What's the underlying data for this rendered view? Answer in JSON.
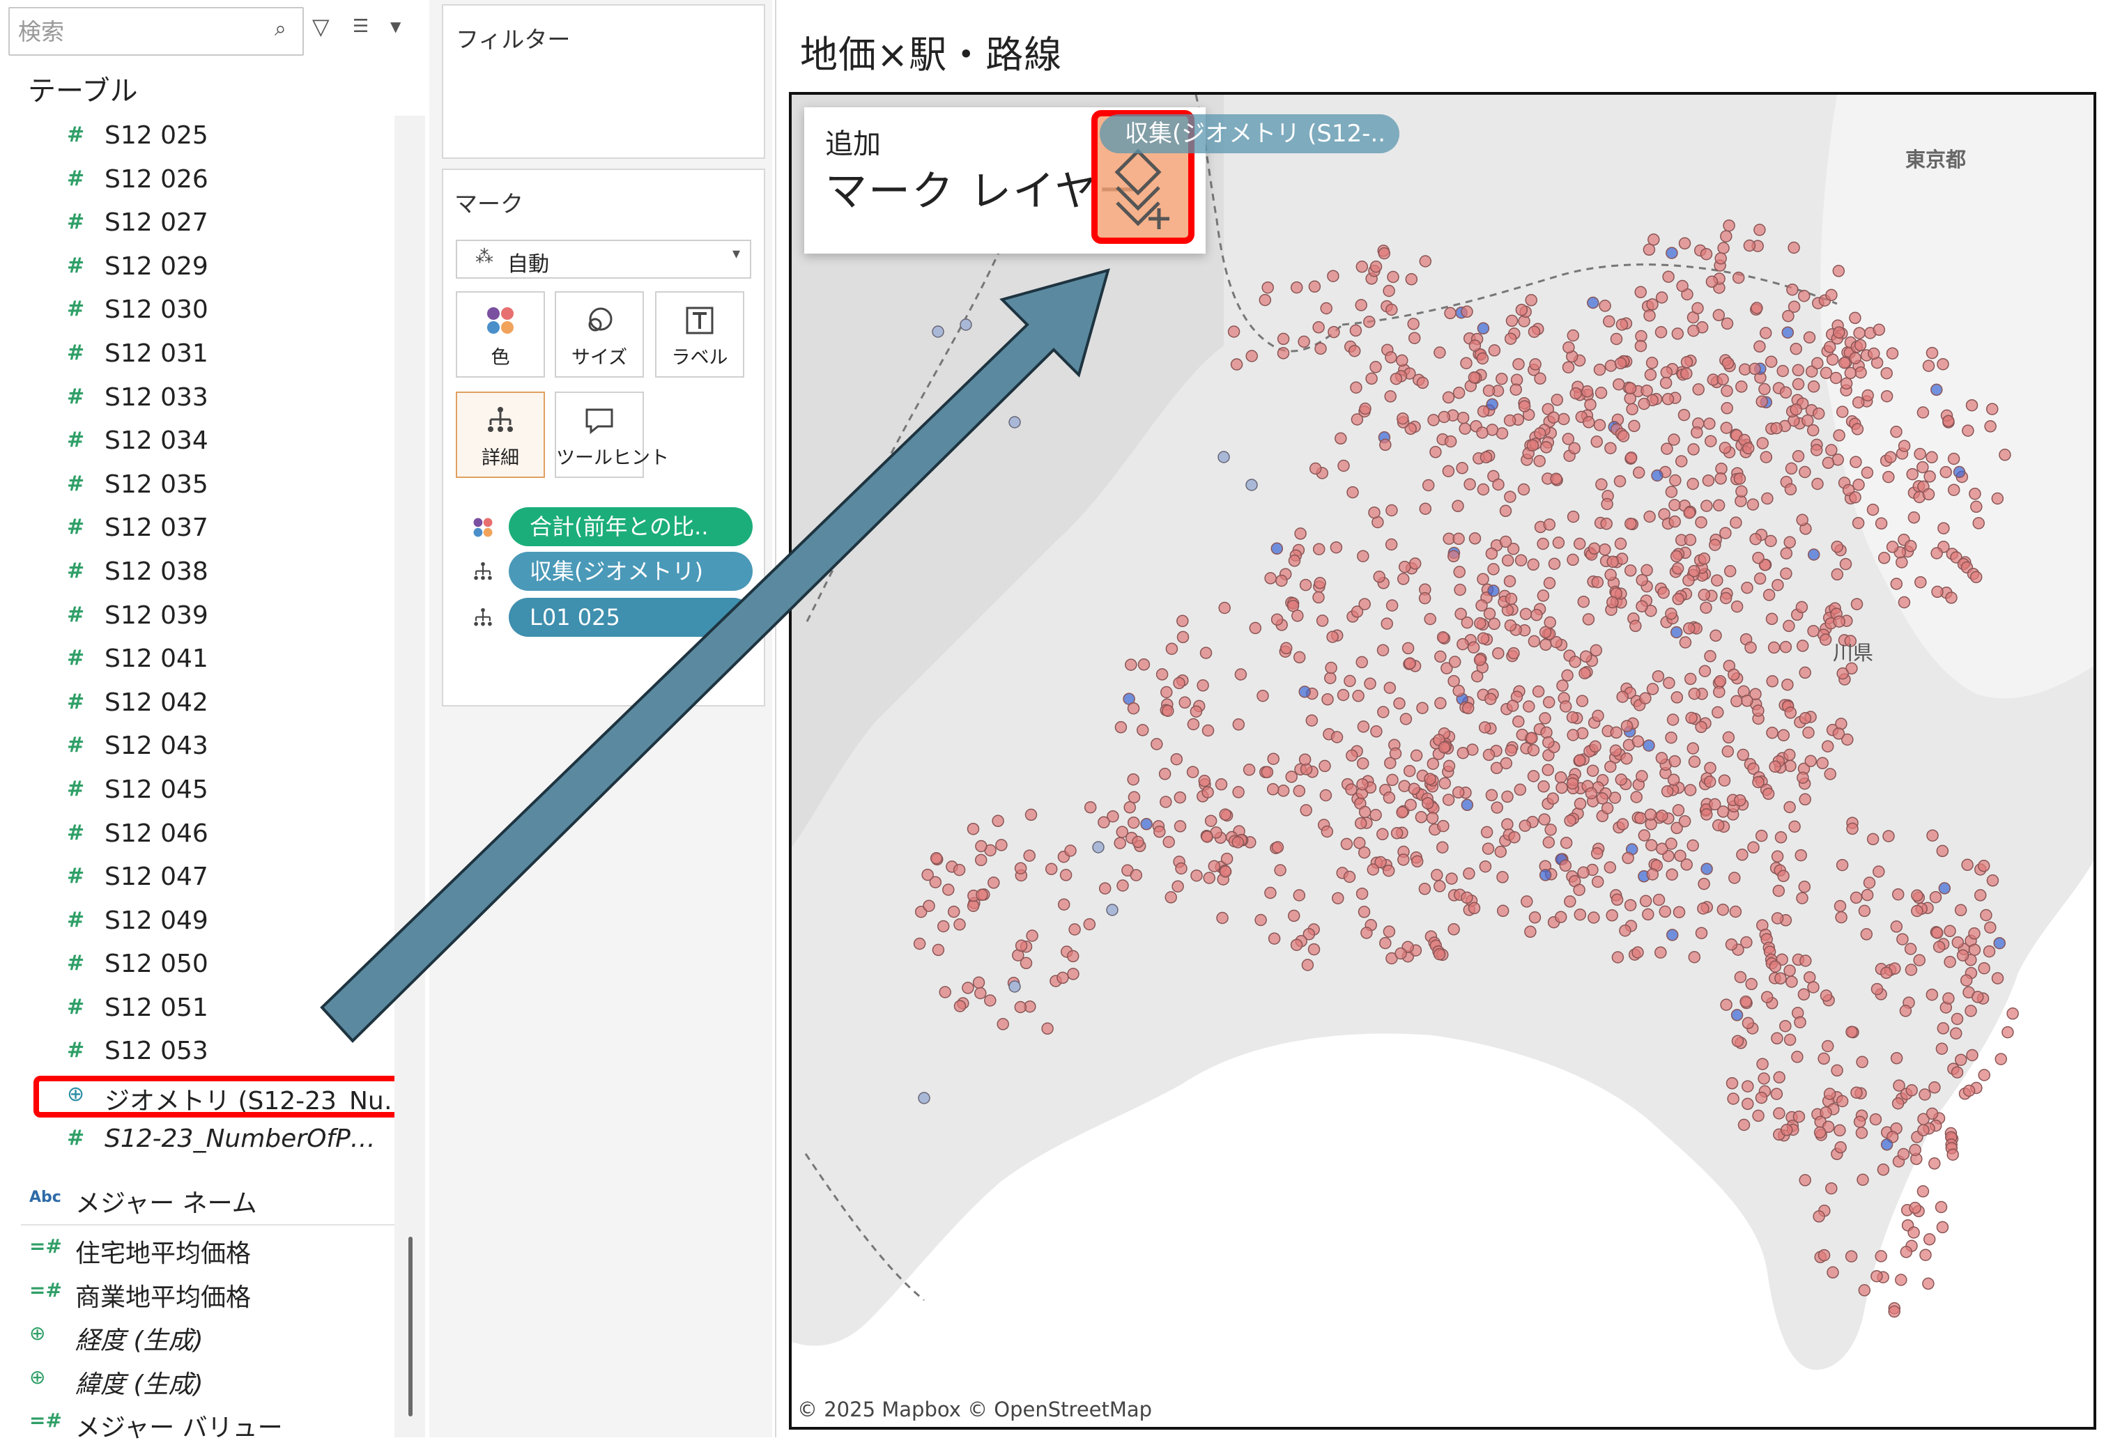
{
  "search": {
    "placeholder": "検索"
  },
  "tables_heading": "テーブル",
  "fields": [
    "S12 025",
    "S12 026",
    "S12 027",
    "S12 029",
    "S12 030",
    "S12 031",
    "S12 033",
    "S12 034",
    "S12 035",
    "S12 037",
    "S12 038",
    "S12 039",
    "S12 041",
    "S12 042",
    "S12 043",
    "S12 045",
    "S12 046",
    "S12 047",
    "S12 049",
    "S12 050",
    "S12 051",
    "S12 053"
  ],
  "geometry_field": "ジオメトリ (S12-23_Nu…",
  "count_field": "S12-23_NumberOfP…",
  "measures": {
    "names": "メジャー ネーム",
    "items": [
      {
        "label": "住宅地平均価格",
        "kind": "measure"
      },
      {
        "label": "商業地平均価格",
        "kind": "measure"
      },
      {
        "label": "経度 (生成)",
        "kind": "geo"
      },
      {
        "label": "緯度 (生成)",
        "kind": "geo"
      },
      {
        "label": "メジャー バリュー",
        "kind": "measure"
      }
    ]
  },
  "filters": {
    "title": "フィルター"
  },
  "marks": {
    "title": "マーク",
    "type": "自動",
    "buttons": {
      "color": "色",
      "size": "サイズ",
      "label": "ラベル",
      "detail": "詳細",
      "tooltip": "ツールヒント"
    },
    "pills": [
      {
        "text": "合計(前年との比..",
        "style": "green"
      },
      {
        "text": "収集(ジオメトリ)",
        "style": "blue"
      },
      {
        "text": "L01 025",
        "style": "blue dark"
      }
    ]
  },
  "view": {
    "title": "地価×駅・路線",
    "attribution": "© 2025 Mapbox © OpenStreetMap",
    "map_labels": {
      "tokyo": "東京都",
      "kanagawa": "川県"
    }
  },
  "overlay": {
    "add": "追加",
    "title": "マーク レイヤー",
    "drag_pill": "収集(ジオメトリ (S12-.."
  },
  "colors": {
    "point_red": "#e07b7b",
    "point_blue": "#3a66d6",
    "highlight": "#ff0000",
    "arrow": "#5b8aa0",
    "pill_green": "#1cae7a",
    "pill_blue": "#4a99b8"
  }
}
